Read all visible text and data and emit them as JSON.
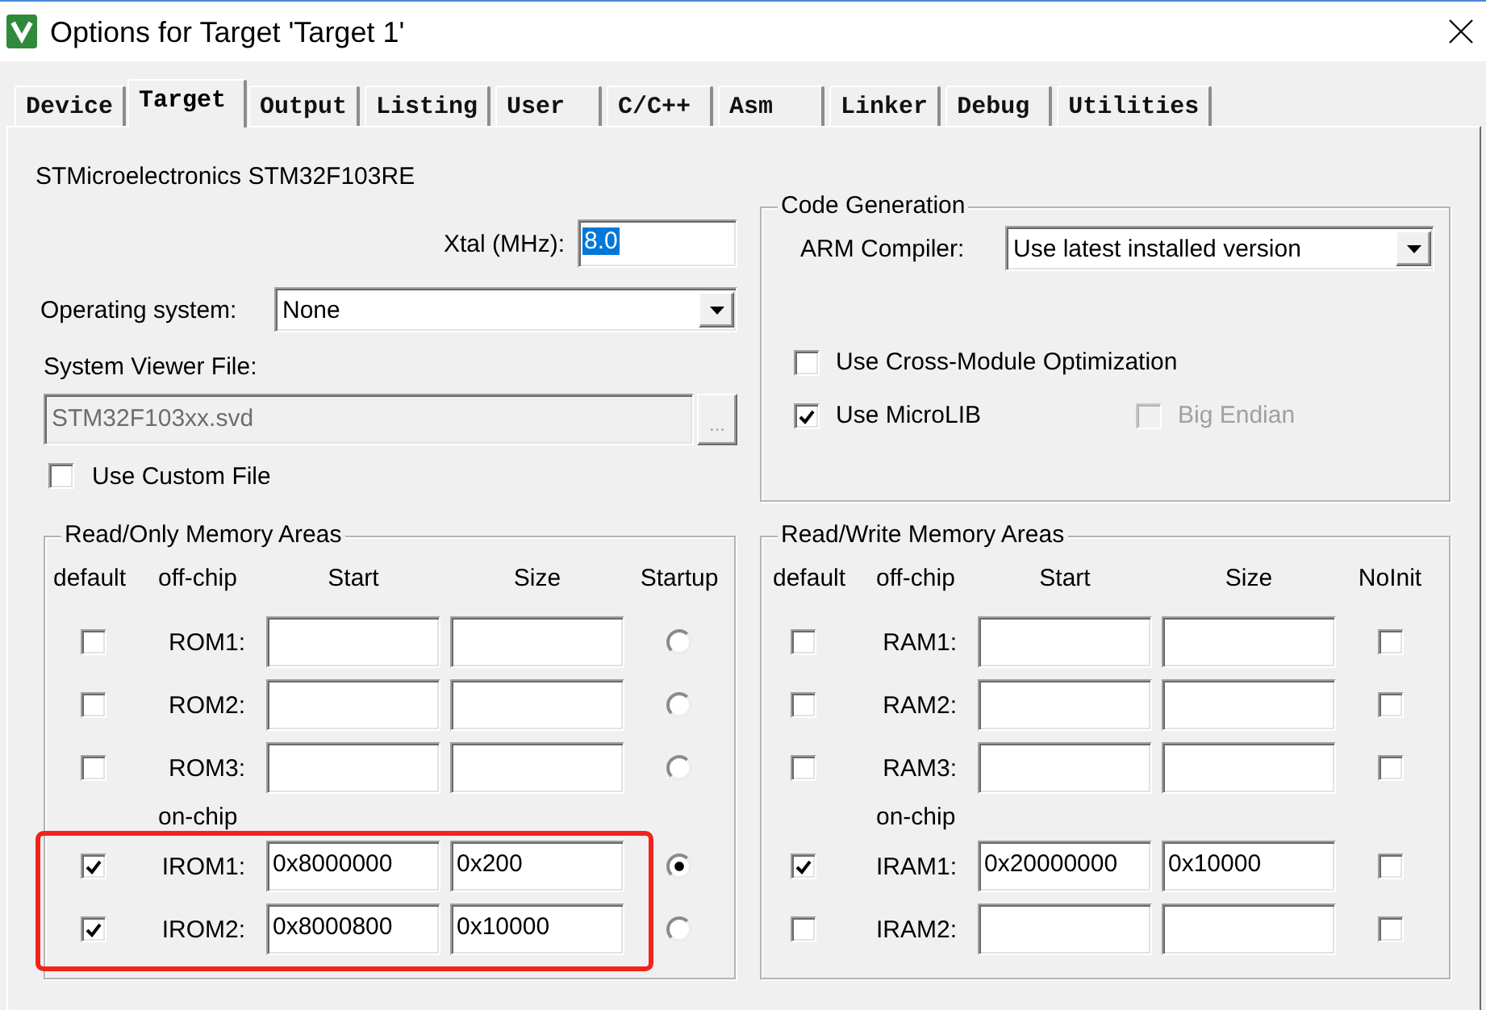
{
  "window": {
    "title": "Options for Target 'Target 1'"
  },
  "tabs": [
    {
      "label": "Device",
      "selected": false
    },
    {
      "label": "Target",
      "selected": true
    },
    {
      "label": "Output",
      "selected": false
    },
    {
      "label": "Listing",
      "selected": false
    },
    {
      "label": "User",
      "selected": false
    },
    {
      "label": "C/C++",
      "selected": false
    },
    {
      "label": "Asm",
      "selected": false
    },
    {
      "label": "Linker",
      "selected": false
    },
    {
      "label": "Debug",
      "selected": false
    },
    {
      "label": "Utilities",
      "selected": false
    }
  ],
  "device": {
    "name": "STMicroelectronics STM32F103RE"
  },
  "xtal": {
    "label": "Xtal (MHz):",
    "value": "8.0",
    "value_selected": true
  },
  "operating_system": {
    "label": "Operating system:",
    "value": "None"
  },
  "system_viewer_file": {
    "label": "System Viewer File:",
    "value": "STM32F103xx.svd",
    "disabled": true,
    "browse_label": "..."
  },
  "use_custom_file": {
    "label": "Use Custom File",
    "checked": false
  },
  "code_generation": {
    "title": "Code Generation",
    "compiler_label": "ARM Compiler:",
    "compiler_value": "Use latest installed version",
    "option_rows": [
      [
        {
          "label": "Use Cross-Module Optimization",
          "checked": false,
          "disabled": false
        }
      ],
      [
        {
          "label": "Use MicroLIB",
          "checked": true,
          "disabled": false
        },
        {
          "label": "Big Endian",
          "checked": false,
          "disabled": true
        }
      ]
    ]
  },
  "read_only_memory": {
    "title": "Read/Only Memory Areas",
    "kind": "rom",
    "columns": [
      "default",
      "off-chip",
      "Start",
      "Size",
      "Startup"
    ],
    "off_chip_rows": [
      {
        "default_checked": false,
        "label": "ROM1:",
        "startup_selected": false
      },
      {
        "default_checked": false,
        "label": "ROM2:",
        "startup_selected": false
      },
      {
        "default_checked": false,
        "label": "ROM3:",
        "startup_selected": false
      }
    ],
    "on_chip": {
      "label": "on-chip",
      "highlighted": true,
      "rows": [
        {
          "default_checked": true,
          "label": "IROM1:",
          "start": "0x8000000",
          "size": "0x200",
          "startup_selected": true
        },
        {
          "default_checked": true,
          "label": "IROM2:",
          "start": "0x8000800",
          "size": "0x10000",
          "startup_selected": false
        }
      ]
    }
  },
  "read_write_memory": {
    "title": "Read/Write Memory Areas",
    "kind": "ram",
    "columns": [
      "default",
      "off-chip",
      "Start",
      "Size",
      "NoInit"
    ],
    "off_chip_rows": [
      {
        "default_checked": false,
        "label": "RAM1:",
        "no_init_checked": false
      },
      {
        "default_checked": false,
        "label": "RAM2:",
        "no_init_checked": false
      },
      {
        "default_checked": false,
        "label": "RAM3:",
        "no_init_checked": false
      }
    ],
    "on_chip": {
      "label": "on-chip",
      "highlighted": false,
      "rows": [
        {
          "default_checked": true,
          "label": "IRAM1:",
          "start": "0x20000000",
          "size": "0x10000",
          "no_init_checked": false
        },
        {
          "default_checked": false,
          "label": "IRAM2:",
          "no_init_checked": false
        }
      ]
    }
  }
}
